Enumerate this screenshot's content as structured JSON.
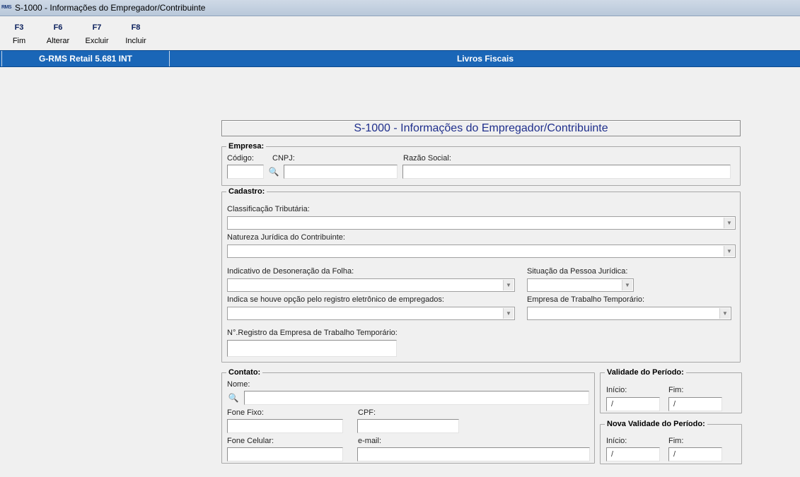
{
  "window": {
    "title": "S-1000 - Informações do Empregador/Contribuinte",
    "icon_text": "RMS"
  },
  "toolbar": [
    {
      "key": "F3",
      "label": "Fim"
    },
    {
      "key": "F6",
      "label": "Alterar"
    },
    {
      "key": "F7",
      "label": "Excluir"
    },
    {
      "key": "F8",
      "label": "Incluir"
    }
  ],
  "header": {
    "app_version": "G-RMS Retail 5.681 INT",
    "module": "Livros Fiscais"
  },
  "form": {
    "title": "S-1000 - Informações do Empregador/Contribuinte",
    "empresa": {
      "legend": "Empresa:",
      "codigo_label": "Código:",
      "codigo_value": "",
      "cnpj_label": "CNPJ:",
      "cnpj_value": "",
      "razao_label": "Razão Social:",
      "razao_value": ""
    },
    "cadastro": {
      "legend": "Cadastro:",
      "classificacao_label": "Classificação Tributária:",
      "classificacao_value": "",
      "natureza_label": "Natureza Jurídica do Contribuinte:",
      "natureza_value": "",
      "desoneracao_label": "Indicativo de Desoneração da Folha:",
      "desoneracao_value": "",
      "situacao_label": "Situação da Pessoa Jurídica:",
      "situacao_value": "",
      "registro_eletronico_label": "Indica se houve opção pelo registro eletrônico de empregados:",
      "registro_eletronico_value": "",
      "trabalho_temporario_label": "Empresa de Trabalho Temporário:",
      "trabalho_temporario_value": "",
      "nr_registro_label": "N°.Registro da Empresa de Trabalho Temporário:",
      "nr_registro_value": ""
    },
    "contato": {
      "legend": "Contato:",
      "nome_label": "Nome:",
      "nome_value": "",
      "fone_fixo_label": "Fone Fixo:",
      "fone_fixo_value": "",
      "cpf_label": "CPF:",
      "cpf_value": "",
      "fone_celular_label": "Fone Celular:",
      "fone_celular_value": "",
      "email_label": "e-mail:",
      "email_value": ""
    },
    "validade": {
      "legend": "Validade do Período:",
      "inicio_label": "Início:",
      "inicio_value": " /",
      "fim_label": "Fim:",
      "fim_value": " /"
    },
    "nova_validade": {
      "legend": "Nova Validade do Período:",
      "inicio_label": "Início:",
      "inicio_value": " /",
      "fim_label": "Fim:",
      "fim_value": " /"
    }
  },
  "icons": {
    "lookup": "binoculars-icon",
    "dropdown": "chevron-down-icon"
  }
}
